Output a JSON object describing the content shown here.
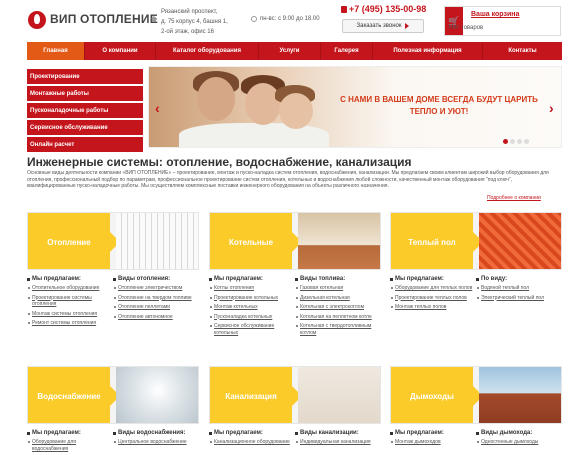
{
  "header": {
    "logo_text": "ВИП ОТОПЛЕНИЕ",
    "address_lines": [
      "Рязанский проспект,",
      "д. 75 корпус 4, башня 1,",
      "2-ой этаж, офис 16"
    ],
    "hours": "пн-вс: с 9.00 до 18.00",
    "phone": "+7 (495) 135-00-98",
    "callback_label": "Заказать звонок",
    "cart_title": "Ваша корзина",
    "cart_empty": "Нет товаров"
  },
  "nav": [
    "Главная",
    "О компании",
    "Каталог оборудования",
    "Услуги",
    "Галерея",
    "Полезная информация",
    "Контакты"
  ],
  "sidebar": [
    "Проектирование",
    "Монтажные работы",
    "Пусконаладочные работы",
    "Сервисное обслуживание",
    "Онлайн расчет"
  ],
  "banner": {
    "text": "С НАМИ В ВАШЕМ ДОМЕ ВСЕГДА БУДУТ ЦАРИТЬ ТЕПЛО И УЮТ!"
  },
  "main": {
    "title": "Инженерные системы: отопление, водоснабжение, канализация",
    "intro": "Основные виды деятельности компании «ВИП ОТОПЛЕНИЕ» – проектирование, монтаж и пуско-наладка систем отопления, водоснабжения, канализации. Мы предлагаем своим клиентам широкий выбор оборудования для отопления, профессиональный подбор по параметрам, профессиональное проектирование систем отопления, котельных и водоснабжения любой сложности, качественный монтаж оборудования \"под ключ\", квалифицированные пуско-наладочные работы. Мы осуществляем комплексные поставки инженерного оборудования на объекты различного назначения.",
    "more_link": "Подробнее о компании"
  },
  "cards": [
    {
      "title": "Отопление",
      "col1_h": "Мы предлагаем:",
      "col1": [
        "Отопительное оборудование",
        "Проектирование системы отопления",
        "Монтаж системы отопления",
        "Ремонт системы отопления"
      ],
      "col2_h": "Виды отопления:",
      "col2": [
        "Отопление электричеством",
        "Отопление на твердом топливе",
        "Отопление пеллетами",
        "Отопление автономное"
      ]
    },
    {
      "title": "Котельные",
      "col1_h": "Мы предлагаем:",
      "col1": [
        "Котлы отопления",
        "Проектирование котельных",
        "Монтаж котельных",
        "Пусконаладка котельных",
        "Сервисное обслуживание котельных"
      ],
      "col2_h": "Виды топлива:",
      "col2": [
        "Газовая котельная",
        "Дизельная котельная",
        "Котельная с электрокотлом",
        "Котельная на пеллетном котле",
        "Котельная с твердотопливным котлом"
      ]
    },
    {
      "title": "Теплый пол",
      "col1_h": "Мы предлагаем:",
      "col1": [
        "Оборудование для теплых полов",
        "Проектирование теплых полов",
        "Монтаж теплых полов"
      ],
      "col2_h": "По виду:",
      "col2": [
        "Водяной теплый пол",
        "Электрический теплый пол"
      ]
    },
    {
      "title": "Водоснабжение",
      "col1_h": "Мы предлагаем:",
      "col1": [
        "Оборудование для водоснабжения"
      ],
      "col2_h": "Виды водоснабжения:",
      "col2": [
        "Центральное водоснабжение"
      ]
    },
    {
      "title": "Канализация",
      "col1_h": "Мы предлагаем:",
      "col1": [
        "Канализационное оборудование"
      ],
      "col2_h": "Виды канализации:",
      "col2": [
        "Индивидуальная канализация"
      ]
    },
    {
      "title": "Дымоходы",
      "col1_h": "Мы предлагаем:",
      "col1": [
        "Монтаж дымоходов"
      ],
      "col2_h": "Виды дымохода:",
      "col2": [
        "Одностенные дымоходы"
      ]
    }
  ]
}
